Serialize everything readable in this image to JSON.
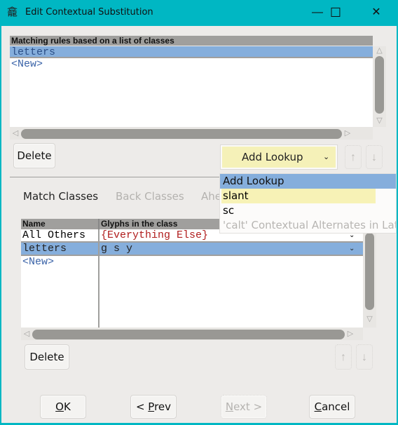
{
  "window": {
    "title": "Edit Contextual Substitution",
    "app_icon": "fontforge-icon",
    "controls": {
      "minimize": "—",
      "maximize": "☐",
      "close": "✕"
    }
  },
  "rules": {
    "header": "Matching rules based on a list of classes",
    "items": [
      {
        "label": "letters",
        "selected": true
      },
      {
        "label": "<New>",
        "selected": false
      }
    ],
    "delete_label": "Delete"
  },
  "lookup": {
    "combo_value": "Add Lookup",
    "up_label": "↑",
    "down_label": "↓",
    "dropdown": [
      {
        "label": "Add Lookup",
        "state": "selected"
      },
      {
        "label": "slant",
        "state": "hover"
      },
      {
        "label": "sc",
        "state": "normal"
      },
      {
        "label": "'calt' Contextual Alternates in Latin",
        "state": "disabled"
      }
    ]
  },
  "tabs": [
    {
      "label": "Match Classes",
      "active": true
    },
    {
      "label": "Back Classes",
      "active": false
    },
    {
      "label": "Ahead Classes",
      "active": false
    }
  ],
  "classes": {
    "columns": [
      "Name",
      "Glyphs in the class"
    ],
    "rows": [
      {
        "name": "All Others",
        "glyphs": "{Everything Else}",
        "selected": false
      },
      {
        "name": "letters",
        "glyphs": "g s y",
        "selected": true
      },
      {
        "name": "<New>",
        "glyphs": "",
        "selected": false
      }
    ],
    "delete_label": "Delete"
  },
  "footer": {
    "ok": {
      "mnemonic": "O",
      "rest": "K"
    },
    "prev": {
      "prefix": "< ",
      "mnemonic": "P",
      "rest": "rev"
    },
    "next": {
      "mnemonic": "N",
      "rest": "ext >"
    },
    "cancel": {
      "mnemonic": "C",
      "rest": "ancel"
    }
  }
}
